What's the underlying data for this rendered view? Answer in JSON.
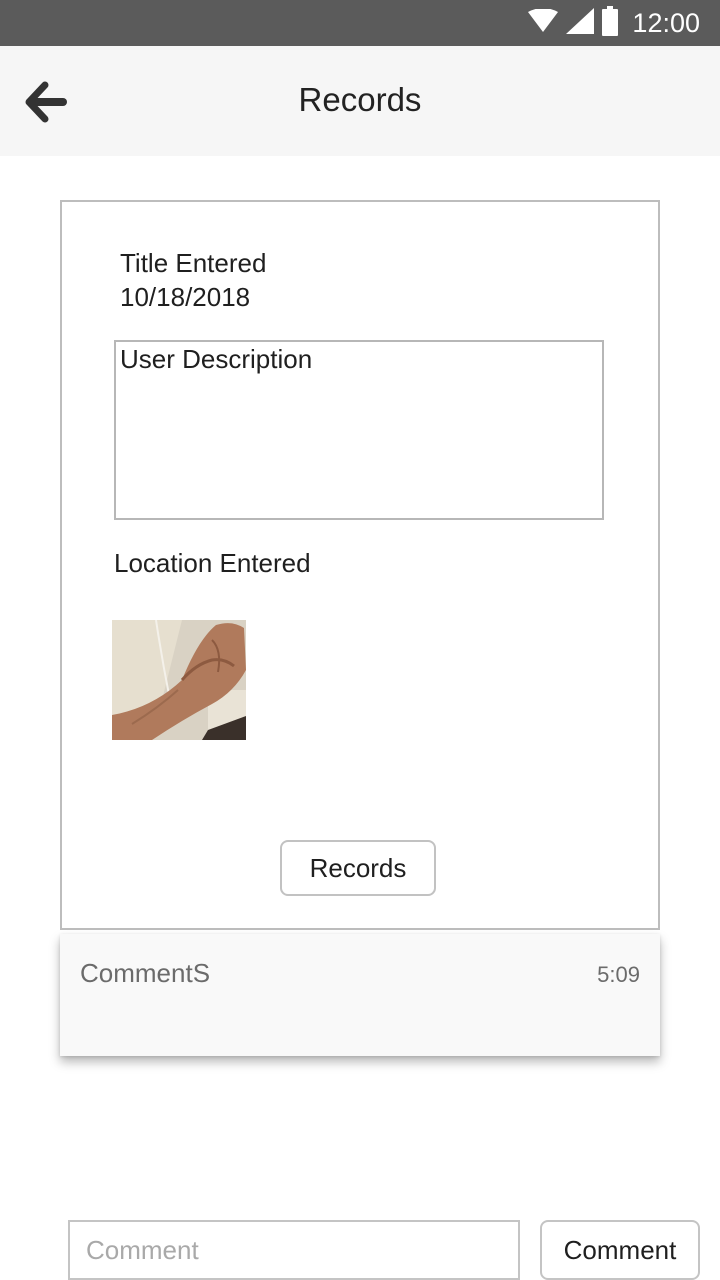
{
  "status_bar": {
    "time": "12:00",
    "icons": [
      "wifi-icon",
      "signal-icon",
      "battery-icon"
    ]
  },
  "app_bar": {
    "title": "Records",
    "back_icon": "arrow-left-icon"
  },
  "record": {
    "title": "Title Entered",
    "date": "10/18/2018",
    "description": "User Description",
    "location": "Location Entered",
    "photo_icon": "hand-photo",
    "records_button_label": "Records"
  },
  "comments": {
    "label": "CommentS",
    "time": "5:09"
  },
  "composer": {
    "placeholder": "Comment",
    "value": "",
    "button_label": "Comment"
  },
  "colors": {
    "status_bar": "#5b5b5b",
    "app_bar": "#f6f6f6",
    "border": "#bdbdbd",
    "muted_text": "#6b6b6b"
  }
}
